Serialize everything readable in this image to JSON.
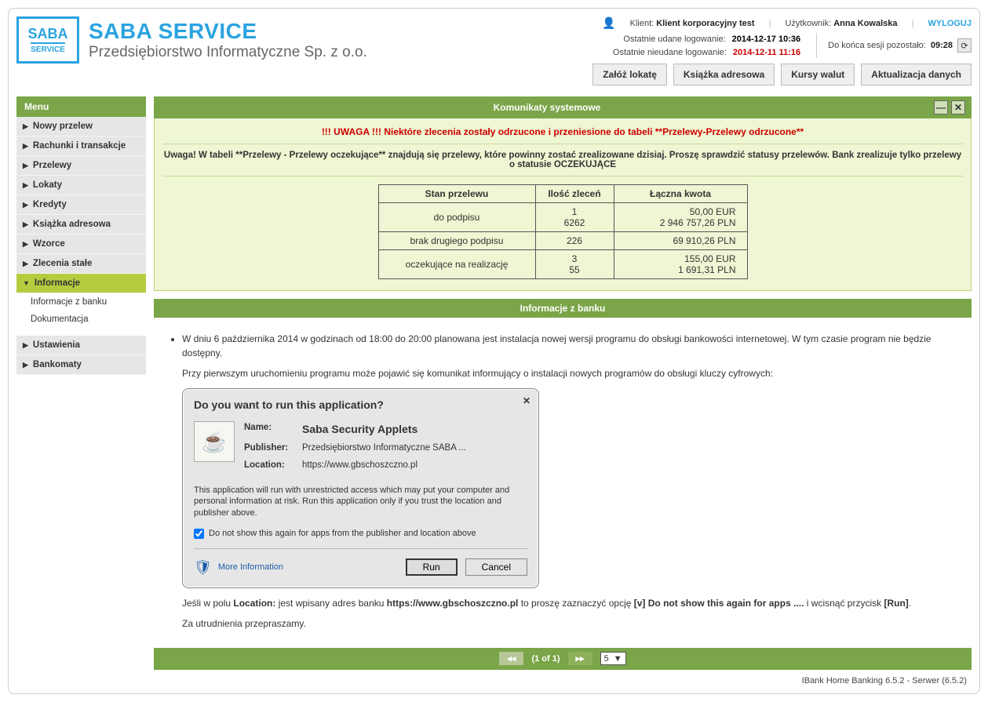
{
  "logo": {
    "box_top": "SABA",
    "box_bot": "SERVICE",
    "line1": "SABA SERVICE",
    "line2": "Przedsiębiorstwo Informatyczne Sp. z o.o."
  },
  "header": {
    "client_label": "Klient:",
    "client_value": "Klient korporacyjny test",
    "user_label": "Użytkownik:",
    "user_value": "Anna Kowalska",
    "logout": "WYLOGUJ",
    "last_ok_label": "Ostatnie udane logowanie:",
    "last_ok_value": "2014-12-17 10:36",
    "last_fail_label": "Ostatnie nieudane logowanie:",
    "last_fail_value": "2014-12-11 11:16",
    "session_label": "Do końca sesji pozostało:",
    "session_value": "09:28",
    "refresh_glyph": "⟳"
  },
  "toolbar": {
    "b1": "Załóż lokatę",
    "b2": "Książka adresowa",
    "b3": "Kursy walut",
    "b4": "Aktualizacja danych"
  },
  "menu": {
    "title": "Menu",
    "items": {
      "i0": "Nowy przelew",
      "i1": "Rachunki i transakcje",
      "i2": "Przelewy",
      "i3": "Lokaty",
      "i4": "Kredyty",
      "i5": "Książka adresowa",
      "i6": "Wzorce",
      "i7": "Zlecenia stałe",
      "i8": "Informacje",
      "s1": "Informacje z banku",
      "s2": "Dokumentacja",
      "i9": "Ustawienia",
      "i10": "Bankomaty"
    }
  },
  "glyph": {
    "right": "▶",
    "down": "▼"
  },
  "sys": {
    "title": "Komunikaty systemowe",
    "minus": "—",
    "close": "✕",
    "alert": "!!! UWAGA !!! Niektóre zlecenia zostały odrzucone i przeniesione do tabeli **Przelewy-Przelewy odrzucone**",
    "info": "Uwaga! W tabeli **Przelewy - Przelewy oczekujące** znajdują się przelewy, które powinny zostać zrealizowane dzisiaj. Proszę sprawdzić statusy przelewów. Bank zrealizuje tylko przelewy o statusie OCZEKUJĄCE",
    "th1": "Stan przelewu",
    "th2": "Ilość zleceń",
    "th3": "Łączna kwota",
    "r1": {
      "name": "do podpisu",
      "c1": "1",
      "c2": "6262",
      "a1": "50,00 EUR",
      "a2": "2 946 757,26 PLN"
    },
    "r2": {
      "name": "brak drugiego podpisu",
      "c1": "226",
      "a1": "69 910,26 PLN"
    },
    "r3": {
      "name": "oczekujące na realizację",
      "c1": "3",
      "c2": "55",
      "a1": "155,00 EUR",
      "a2": "1 691,31 PLN"
    }
  },
  "bank": {
    "title": "Informacje z banku",
    "p1": "W dniu 6 października 2014 w godzinach od 18:00 do 20:00 planowana jest instalacja nowej wersji programu do obsługi bankowości internetowej. W tym czasie program nie będzie dostępny.",
    "p2": "Przy pierwszym uruchomieniu programu może pojawić się komunikat informujący o instalacji nowych programów do obsługi kluczy cyfrowych:",
    "p3a": "Jeśli w polu ",
    "p3b": "Location:",
    "p3c": " jest wpisany adres banku ",
    "p3d": "https://www.gbschoszczno.pl",
    "p3e": " to proszę zaznaczyć opcję ",
    "p3f": "[v] Do not show this again for apps ....",
    "p3g": " i wcisnąć przycisk ",
    "p3h": "[Run]",
    "p3i": ".",
    "p4": "Za utrudnienia przepraszamy."
  },
  "dialog": {
    "title": "Do you want to run this application?",
    "java_glyph": "☕",
    "name_lbl": "Name:",
    "name_val": "Saba Security Applets",
    "pub_lbl": "Publisher:",
    "pub_val": "Przedsiębiorstwo Informatyczne SABA  ...",
    "loc_lbl": "Location:",
    "loc_val": "https://www.gbschoszczno.pl",
    "warn": "This application will run with unrestricted access which may put your computer and personal information at risk. Run this application only if you trust the location and publisher above.",
    "chk": "Do not show this again for apps from the publisher and location above",
    "more": "More Information",
    "shield_glyph": "🛡",
    "run": "Run",
    "cancel": "Cancel",
    "close_x": "✕"
  },
  "pager": {
    "first": "◂◂",
    "prev": "",
    "text": "(1 of 1)",
    "next": "▸▸",
    "size": "5",
    "drop": "▼"
  },
  "footer": {
    "text": "IBank Home Banking 6.5.2 - Serwer (6.5.2)"
  }
}
